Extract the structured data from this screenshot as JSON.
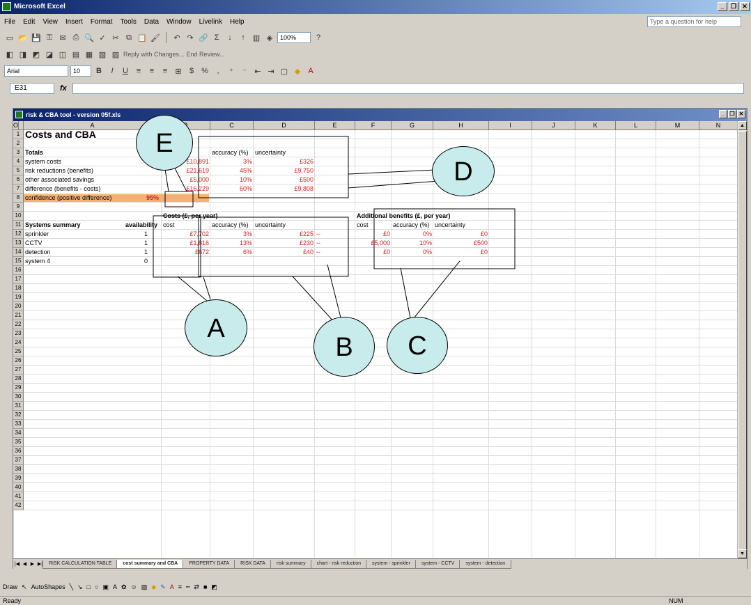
{
  "app": {
    "title": "Microsoft Excel"
  },
  "menu": [
    "File",
    "Edit",
    "View",
    "Insert",
    "Format",
    "Tools",
    "Data",
    "Window",
    "Livelink",
    "Help"
  ],
  "help_placeholder": "Type a question for help",
  "toolbar": {
    "zoom": "100%",
    "reply_text": "Reply with Changes...",
    "end_review": "End Review..."
  },
  "format_bar": {
    "font": "Arial",
    "size": "10"
  },
  "name_box": "E31",
  "fx": "fx",
  "workbook": {
    "title": "risk & CBA tool - version 05f.xls"
  },
  "columns": [
    "A",
    "B",
    "C",
    "D",
    "E",
    "F",
    "G",
    "H",
    "I",
    "J",
    "K",
    "L",
    "M",
    "N",
    "O"
  ],
  "rows": [
    "1",
    "2",
    "3",
    "4",
    "5",
    "6",
    "7",
    "8",
    "9",
    "10",
    "11",
    "12",
    "13",
    "14",
    "15",
    "16",
    "17",
    "18",
    "19",
    "20",
    "21",
    "22",
    "23",
    "24",
    "25",
    "26",
    "27",
    "28",
    "29",
    "30",
    "31",
    "32",
    "33",
    "34",
    "35",
    "36",
    "37",
    "38",
    "39",
    "40",
    "41",
    "42"
  ],
  "sheet": {
    "title": "Costs and CBA",
    "totals_label": "Totals",
    "totals_header": {
      "cost": "cost",
      "accuracy": "accuracy (%)",
      "uncertainty": "uncertainty"
    },
    "totals": [
      {
        "label": "system costs",
        "cost": "£10,891",
        "accuracy": "3%",
        "uncertainty": "£326"
      },
      {
        "label": "risk reductions (benefits)",
        "cost": "£21,619",
        "accuracy": "45%",
        "uncertainty": "£9,750"
      },
      {
        "label": "other associated savings",
        "cost": "£5,000",
        "accuracy": "10%",
        "uncertainty": "£500"
      },
      {
        "label": "difference (benefits - costs)",
        "cost": "£16,229",
        "accuracy": "60%",
        "uncertainty": "£9,808"
      }
    ],
    "confidence_label": "confidence (positive difference)",
    "confidence_value": "95%",
    "costs_header": "Costs (£, per year)",
    "benefits_header": "Additional benefits (£, per year)",
    "systems_label": "Systems summary",
    "availability_label": "availability",
    "sub_header": {
      "cost": "cost",
      "accuracy": "accuracy (%)",
      "uncertainty": "uncertainty"
    },
    "systems": [
      {
        "name": "sprinkler",
        "availability": "1",
        "cost": "£7,702",
        "accuracy": "3%",
        "uncertainty": "£225",
        "dash": "--",
        "b_cost": "£0",
        "b_accuracy": "0%",
        "b_uncertainty": "£0"
      },
      {
        "name": "CCTV",
        "availability": "1",
        "cost": "£1,816",
        "accuracy": "13%",
        "uncertainty": "£230",
        "dash": "--",
        "b_cost": "£5,000",
        "b_accuracy": "10%",
        "b_uncertainty": "£500"
      },
      {
        "name": "detection",
        "availability": "1",
        "cost": "£672",
        "accuracy": "6%",
        "uncertainty": "£40",
        "dash": "--",
        "b_cost": "£0",
        "b_accuracy": "0%",
        "b_uncertainty": "£0"
      },
      {
        "name": "system 4",
        "availability": "0",
        "cost": "",
        "accuracy": "",
        "uncertainty": "",
        "dash": "",
        "b_cost": "",
        "b_accuracy": "",
        "b_uncertainty": ""
      }
    ]
  },
  "callouts": {
    "a": "A",
    "b": "B",
    "c": "C",
    "d": "D",
    "e": "E"
  },
  "tabs": [
    "RISK CALCULATION TABLE",
    "cost summary and CBA",
    "PROPERTY DATA",
    "RISK DATA",
    "risk summary",
    "chart - risk reduction",
    "system - sprinkler",
    "system - CCTV",
    "system - detection"
  ],
  "active_tab": 1,
  "drawbar": {
    "draw": "Draw",
    "autoshapes": "AutoShapes"
  },
  "status": {
    "ready": "Ready",
    "num": "NUM"
  }
}
